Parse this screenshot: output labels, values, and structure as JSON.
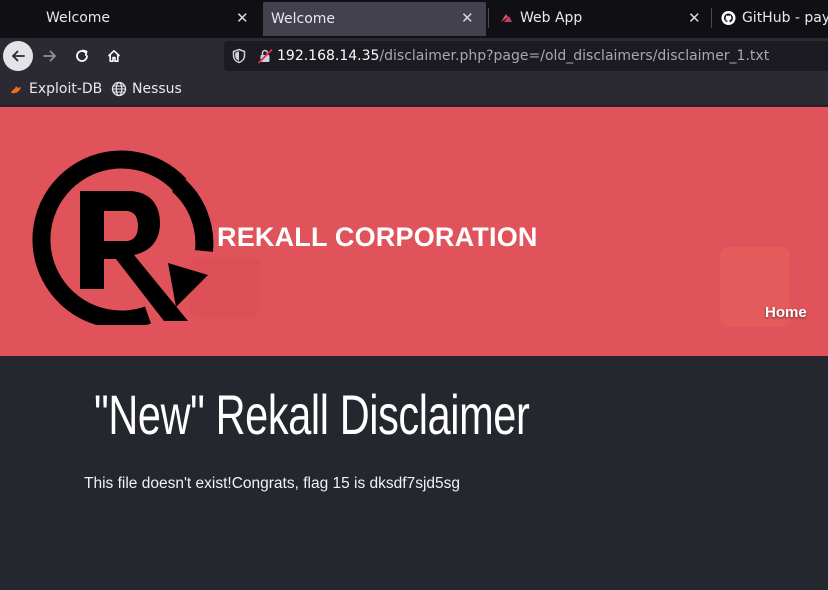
{
  "browser": {
    "tabs": [
      {
        "label": "Welcome",
        "active": false
      },
      {
        "label": "Welcome",
        "active": true
      },
      {
        "label": "Web App",
        "active": false
      },
      {
        "label": "GitHub - payl",
        "active": false
      }
    ],
    "close_glyph": "✕",
    "address": {
      "host": "192.168.14.35",
      "path": "/disclaimer.php?page=/old_disclaimers/disclaimer_1.txt"
    },
    "bookmarks": [
      {
        "label": "Exploit-DB",
        "icon": "exploit-db-icon"
      },
      {
        "label": "Nessus",
        "icon": "globe-icon"
      }
    ]
  },
  "page": {
    "company_name": "REKALL CORPORATION",
    "nav_home": "Home",
    "title": "\"New\" Rekall Disclaimer",
    "message": "This file doesn't exist!Congrats, flag 15 is dksdf7sjd5sg"
  },
  "colors": {
    "hero_background": "#e0535a",
    "page_background": "#24272d",
    "logo": "#000000"
  }
}
